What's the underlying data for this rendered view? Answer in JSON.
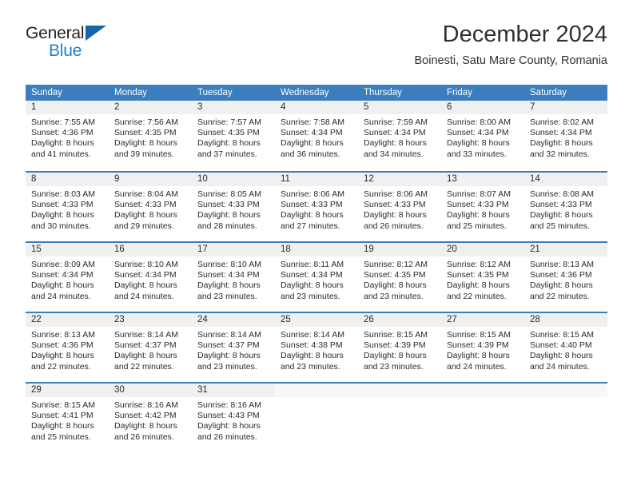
{
  "brand": {
    "line1": "General",
    "line2": "Blue",
    "triangle_color": "#1565a8",
    "blue_text_color": "#1a7fd4"
  },
  "header": {
    "title": "December 2024",
    "subtitle": "Boinesti, Satu Mare County, Romania"
  },
  "theme": {
    "header_blue": "#3a7ebe",
    "daynum_band": "#f0f0f0",
    "text": "#2b2b2b"
  },
  "calendar": {
    "day_headers": [
      "Sunday",
      "Monday",
      "Tuesday",
      "Wednesday",
      "Thursday",
      "Friday",
      "Saturday"
    ],
    "weeks": [
      [
        {
          "day": "1",
          "sunrise": "Sunrise: 7:55 AM",
          "sunset": "Sunset: 4:36 PM",
          "daylight1": "Daylight: 8 hours",
          "daylight2": "and 41 minutes."
        },
        {
          "day": "2",
          "sunrise": "Sunrise: 7:56 AM",
          "sunset": "Sunset: 4:35 PM",
          "daylight1": "Daylight: 8 hours",
          "daylight2": "and 39 minutes."
        },
        {
          "day": "3",
          "sunrise": "Sunrise: 7:57 AM",
          "sunset": "Sunset: 4:35 PM",
          "daylight1": "Daylight: 8 hours",
          "daylight2": "and 37 minutes."
        },
        {
          "day": "4",
          "sunrise": "Sunrise: 7:58 AM",
          "sunset": "Sunset: 4:34 PM",
          "daylight1": "Daylight: 8 hours",
          "daylight2": "and 36 minutes."
        },
        {
          "day": "5",
          "sunrise": "Sunrise: 7:59 AM",
          "sunset": "Sunset: 4:34 PM",
          "daylight1": "Daylight: 8 hours",
          "daylight2": "and 34 minutes."
        },
        {
          "day": "6",
          "sunrise": "Sunrise: 8:00 AM",
          "sunset": "Sunset: 4:34 PM",
          "daylight1": "Daylight: 8 hours",
          "daylight2": "and 33 minutes."
        },
        {
          "day": "7",
          "sunrise": "Sunrise: 8:02 AM",
          "sunset": "Sunset: 4:34 PM",
          "daylight1": "Daylight: 8 hours",
          "daylight2": "and 32 minutes."
        }
      ],
      [
        {
          "day": "8",
          "sunrise": "Sunrise: 8:03 AM",
          "sunset": "Sunset: 4:33 PM",
          "daylight1": "Daylight: 8 hours",
          "daylight2": "and 30 minutes."
        },
        {
          "day": "9",
          "sunrise": "Sunrise: 8:04 AM",
          "sunset": "Sunset: 4:33 PM",
          "daylight1": "Daylight: 8 hours",
          "daylight2": "and 29 minutes."
        },
        {
          "day": "10",
          "sunrise": "Sunrise: 8:05 AM",
          "sunset": "Sunset: 4:33 PM",
          "daylight1": "Daylight: 8 hours",
          "daylight2": "and 28 minutes."
        },
        {
          "day": "11",
          "sunrise": "Sunrise: 8:06 AM",
          "sunset": "Sunset: 4:33 PM",
          "daylight1": "Daylight: 8 hours",
          "daylight2": "and 27 minutes."
        },
        {
          "day": "12",
          "sunrise": "Sunrise: 8:06 AM",
          "sunset": "Sunset: 4:33 PM",
          "daylight1": "Daylight: 8 hours",
          "daylight2": "and 26 minutes."
        },
        {
          "day": "13",
          "sunrise": "Sunrise: 8:07 AM",
          "sunset": "Sunset: 4:33 PM",
          "daylight1": "Daylight: 8 hours",
          "daylight2": "and 25 minutes."
        },
        {
          "day": "14",
          "sunrise": "Sunrise: 8:08 AM",
          "sunset": "Sunset: 4:33 PM",
          "daylight1": "Daylight: 8 hours",
          "daylight2": "and 25 minutes."
        }
      ],
      [
        {
          "day": "15",
          "sunrise": "Sunrise: 8:09 AM",
          "sunset": "Sunset: 4:34 PM",
          "daylight1": "Daylight: 8 hours",
          "daylight2": "and 24 minutes."
        },
        {
          "day": "16",
          "sunrise": "Sunrise: 8:10 AM",
          "sunset": "Sunset: 4:34 PM",
          "daylight1": "Daylight: 8 hours",
          "daylight2": "and 24 minutes."
        },
        {
          "day": "17",
          "sunrise": "Sunrise: 8:10 AM",
          "sunset": "Sunset: 4:34 PM",
          "daylight1": "Daylight: 8 hours",
          "daylight2": "and 23 minutes."
        },
        {
          "day": "18",
          "sunrise": "Sunrise: 8:11 AM",
          "sunset": "Sunset: 4:34 PM",
          "daylight1": "Daylight: 8 hours",
          "daylight2": "and 23 minutes."
        },
        {
          "day": "19",
          "sunrise": "Sunrise: 8:12 AM",
          "sunset": "Sunset: 4:35 PM",
          "daylight1": "Daylight: 8 hours",
          "daylight2": "and 23 minutes."
        },
        {
          "day": "20",
          "sunrise": "Sunrise: 8:12 AM",
          "sunset": "Sunset: 4:35 PM",
          "daylight1": "Daylight: 8 hours",
          "daylight2": "and 22 minutes."
        },
        {
          "day": "21",
          "sunrise": "Sunrise: 8:13 AM",
          "sunset": "Sunset: 4:36 PM",
          "daylight1": "Daylight: 8 hours",
          "daylight2": "and 22 minutes."
        }
      ],
      [
        {
          "day": "22",
          "sunrise": "Sunrise: 8:13 AM",
          "sunset": "Sunset: 4:36 PM",
          "daylight1": "Daylight: 8 hours",
          "daylight2": "and 22 minutes."
        },
        {
          "day": "23",
          "sunrise": "Sunrise: 8:14 AM",
          "sunset": "Sunset: 4:37 PM",
          "daylight1": "Daylight: 8 hours",
          "daylight2": "and 22 minutes."
        },
        {
          "day": "24",
          "sunrise": "Sunrise: 8:14 AM",
          "sunset": "Sunset: 4:37 PM",
          "daylight1": "Daylight: 8 hours",
          "daylight2": "and 23 minutes."
        },
        {
          "day": "25",
          "sunrise": "Sunrise: 8:14 AM",
          "sunset": "Sunset: 4:38 PM",
          "daylight1": "Daylight: 8 hours",
          "daylight2": "and 23 minutes."
        },
        {
          "day": "26",
          "sunrise": "Sunrise: 8:15 AM",
          "sunset": "Sunset: 4:39 PM",
          "daylight1": "Daylight: 8 hours",
          "daylight2": "and 23 minutes."
        },
        {
          "day": "27",
          "sunrise": "Sunrise: 8:15 AM",
          "sunset": "Sunset: 4:39 PM",
          "daylight1": "Daylight: 8 hours",
          "daylight2": "and 24 minutes."
        },
        {
          "day": "28",
          "sunrise": "Sunrise: 8:15 AM",
          "sunset": "Sunset: 4:40 PM",
          "daylight1": "Daylight: 8 hours",
          "daylight2": "and 24 minutes."
        }
      ],
      [
        {
          "day": "29",
          "sunrise": "Sunrise: 8:15 AM",
          "sunset": "Sunset: 4:41 PM",
          "daylight1": "Daylight: 8 hours",
          "daylight2": "and 25 minutes."
        },
        {
          "day": "30",
          "sunrise": "Sunrise: 8:16 AM",
          "sunset": "Sunset: 4:42 PM",
          "daylight1": "Daylight: 8 hours",
          "daylight2": "and 26 minutes."
        },
        {
          "day": "31",
          "sunrise": "Sunrise: 8:16 AM",
          "sunset": "Sunset: 4:43 PM",
          "daylight1": "Daylight: 8 hours",
          "daylight2": "and 26 minutes."
        },
        {
          "day": "",
          "sunrise": "",
          "sunset": "",
          "daylight1": "",
          "daylight2": ""
        },
        {
          "day": "",
          "sunrise": "",
          "sunset": "",
          "daylight1": "",
          "daylight2": ""
        },
        {
          "day": "",
          "sunrise": "",
          "sunset": "",
          "daylight1": "",
          "daylight2": ""
        },
        {
          "day": "",
          "sunrise": "",
          "sunset": "",
          "daylight1": "",
          "daylight2": ""
        }
      ]
    ]
  }
}
